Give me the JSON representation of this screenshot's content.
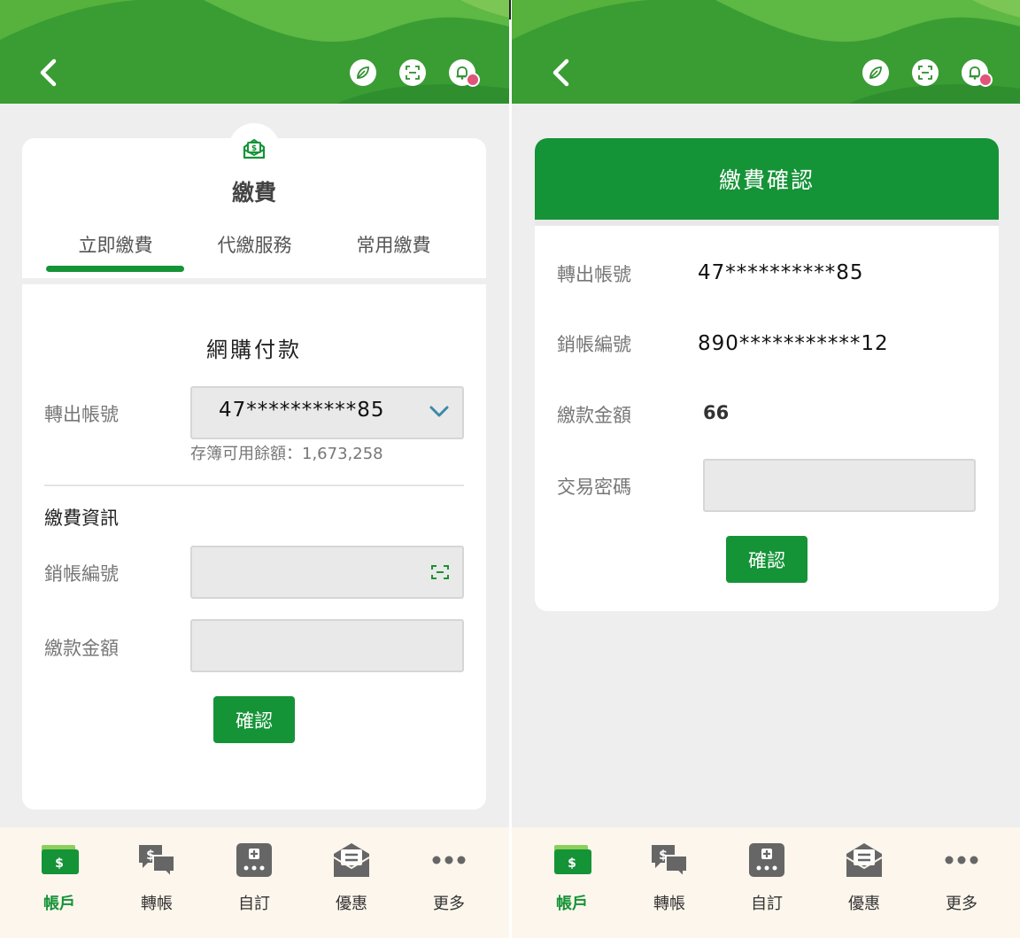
{
  "colors": {
    "brand_green": "#159337",
    "header_green": "#3a9d34",
    "notification_dot": "#e0557a",
    "nav_background": "#fcf6ec"
  },
  "icons": {
    "header": [
      "back-icon",
      "leaf-icon",
      "scan-icon",
      "bell-icon"
    ],
    "nav": [
      "wallet-icon",
      "transfer-chat-icon",
      "custom-grid-icon",
      "envelope-offer-icon",
      "more-dots-icon"
    ]
  },
  "left": {
    "card": {
      "title": "繳費",
      "tabs": [
        "立即繳費",
        "代繳服務",
        "常用繳費"
      ],
      "active_tab": "立即繳費",
      "section_title": "網購付款",
      "account_label": "轉出帳號",
      "account_value": "47**********85",
      "balance_text": "存簿可用餘額：1,673,258",
      "payment_info_heading": "繳費資訊",
      "writeoff_label": "銷帳編號",
      "writeoff_value": "",
      "amount_label": "繳款金額",
      "amount_value": "",
      "confirm_button": "確認"
    }
  },
  "right": {
    "card": {
      "header": "繳費確認",
      "account_label": "轉出帳號",
      "account_value": "47**********85",
      "writeoff_label": "銷帳編號",
      "writeoff_value": "890***********12",
      "amount_label": "繳款金額",
      "amount_value": "66",
      "password_label": "交易密碼",
      "password_value": "",
      "confirm_button": "確認"
    }
  },
  "bottom_nav": {
    "items": [
      {
        "label": "帳戶",
        "active": true
      },
      {
        "label": "轉帳",
        "active": false
      },
      {
        "label": "自訂",
        "active": false
      },
      {
        "label": "優惠",
        "active": false
      },
      {
        "label": "更多",
        "active": false
      }
    ]
  }
}
